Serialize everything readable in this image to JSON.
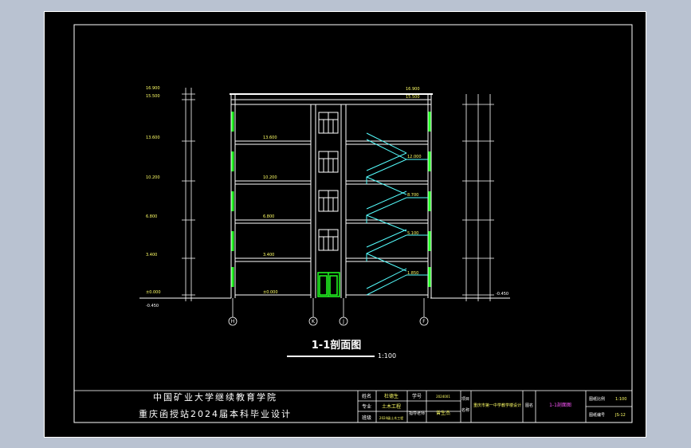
{
  "drawing": {
    "title": "1-1剖面图",
    "scale": "1:100"
  },
  "floors": {
    "roof_level": "15.500",
    "parapet_level": "16.900",
    "levels": [
      "13.600",
      "10.200",
      "6.800",
      "3.400",
      "±0.000"
    ],
    "left_levels": [
      "16.900",
      "15.500",
      "13.600",
      "10.200",
      "6.800",
      "3.400",
      "±0.000",
      "-0.450"
    ],
    "stair_levels": [
      "12.000",
      "8.700",
      "5.100",
      "1.850"
    ],
    "right_level": "-0.450"
  },
  "axes": [
    "H",
    "K",
    "J",
    "F"
  ],
  "title_block": {
    "school_line1": "中国矿业大学继续教育学院",
    "school_line2": "重庆函授站2024届本科毕业设计",
    "cells": {
      "name_label": "姓名",
      "name_value": "杜德生",
      "id_label": "学号",
      "id_value": "2024001",
      "major_label": "专业",
      "major_value": "土木工程",
      "advisor_label": "指导老师",
      "advisor_value": "曾生杰",
      "class_label": "班级",
      "class_value": "2024级土木工程",
      "project_label": "项目",
      "project_name_label": "名称",
      "project_value": "重庆市第一中学教学楼设计",
      "drawing_name_label": "图名",
      "drawing_name_value": "1-1剖面图",
      "scale_label": "图纸比例",
      "scale_value": "1:100",
      "number_label": "图纸编号",
      "number_value": "JS-12"
    }
  }
}
